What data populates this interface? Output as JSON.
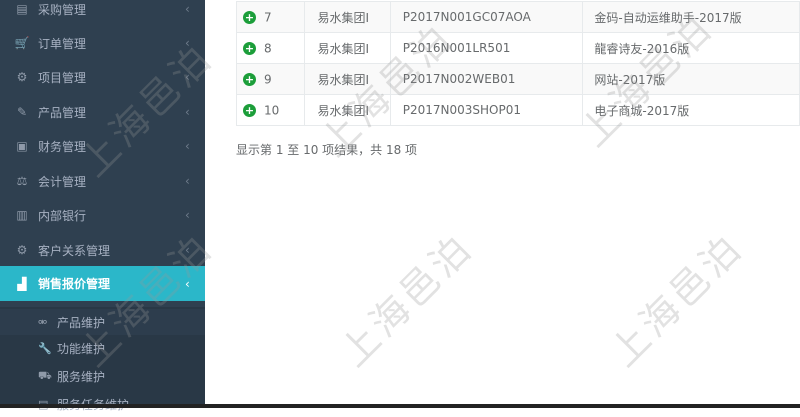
{
  "sidebar": {
    "items": [
      {
        "label": "采购管理",
        "icon": "cart-icon",
        "glyph": "▤"
      },
      {
        "label": "订单管理",
        "icon": "cart-icon",
        "glyph": "🛒"
      },
      {
        "label": "项目管理",
        "icon": "sitemap-icon",
        "glyph": "⚙"
      },
      {
        "label": "产品管理",
        "icon": "edit-icon",
        "glyph": "✎"
      },
      {
        "label": "财务管理",
        "icon": "money-icon",
        "glyph": "▣"
      },
      {
        "label": "会计管理",
        "icon": "balance-icon",
        "glyph": "⚖"
      },
      {
        "label": "内部银行",
        "icon": "bank-icon",
        "glyph": "▥"
      },
      {
        "label": "客户关系管理",
        "icon": "cogs-icon",
        "glyph": "⚙"
      },
      {
        "label": "销售报价管理",
        "icon": "area-chart-icon",
        "glyph": "▟",
        "active": true
      }
    ],
    "chevron": "‹",
    "submenu": [
      {
        "label": "产品维护",
        "icon": "bicycle-icon",
        "glyph": "⚮"
      },
      {
        "label": "功能维护",
        "icon": "wrench-icon",
        "glyph": "🔧"
      },
      {
        "label": "服务维护",
        "icon": "car-icon",
        "glyph": "⛟"
      },
      {
        "label": "服务任务维护",
        "icon": "list-icon",
        "glyph": "▤"
      }
    ]
  },
  "table": {
    "rows": [
      {
        "num": "7",
        "org": "易水集团I",
        "code": "P2017N001GC07AOA",
        "name": "金码-自动运维助手-2017版"
      },
      {
        "num": "8",
        "org": "易水集团I",
        "code": "P2016N001LR501",
        "name": "龍睿诗友-2016版"
      },
      {
        "num": "9",
        "org": "易水集团I",
        "code": "P2017N002WEB01",
        "name": "网站-2017版"
      },
      {
        "num": "10",
        "org": "易水集团I",
        "code": "P2017N003SHOP01",
        "name": "电子商城-2017版"
      }
    ],
    "expand_glyph": "+"
  },
  "pagination": {
    "info": "显示第 1 至 10 项结果，共 18 项"
  },
  "watermark": {
    "text": "上海邑泊"
  },
  "colors": {
    "sidebar_bg": "#2f4050",
    "active_bg": "#2bb7c9",
    "plus_green": "#1c9e3a"
  }
}
